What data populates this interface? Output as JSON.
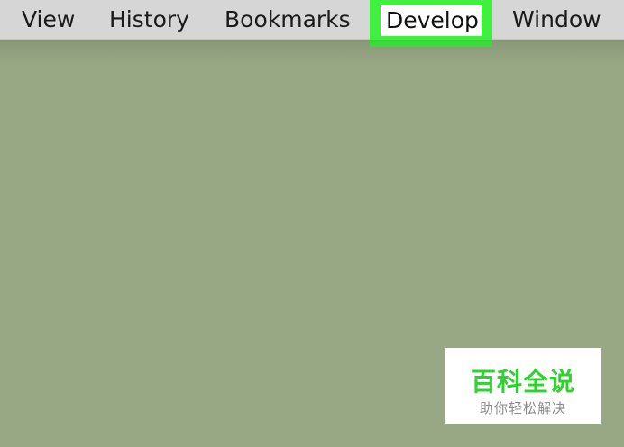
{
  "menubar": {
    "items": [
      {
        "label": "View"
      },
      {
        "label": "History"
      },
      {
        "label": "Bookmarks"
      },
      {
        "label": "Develop",
        "highlighted": true,
        "highlight_color": "#3ff03f"
      },
      {
        "label": "Window"
      }
    ]
  },
  "colors": {
    "menubar_bg": "#d6d6d6",
    "content_bg": "#98a884",
    "highlight": "#3ff03f",
    "watermark_green": "#2fd12f"
  },
  "watermark": {
    "title": "百科全说",
    "subtitle": "助你轻松解决"
  }
}
